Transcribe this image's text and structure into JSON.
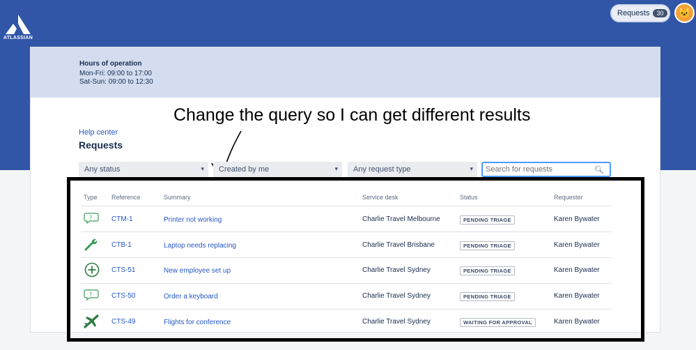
{
  "header": {
    "brand": "ATLASSIAN",
    "requests_label": "Requests",
    "requests_count": "30",
    "avatar_glyph": "🐱"
  },
  "hours": {
    "title": "Hours of operation",
    "weekdays": "Mon-Fri: 09:00 to 17:00",
    "weekend": "Sat-Sun: 09:00 to 12:30"
  },
  "annotation": "Change the query so I can get different results",
  "breadcrumb": "Help center",
  "page_title": "Requests",
  "filters": {
    "status": "Any status",
    "created_by": "Created by me",
    "request_type": "Any request type",
    "search_placeholder": "Search for requests"
  },
  "table": {
    "columns": [
      "Type",
      "Reference",
      "Summary",
      "Service desk",
      "Status",
      "Requester"
    ],
    "rows": [
      {
        "type_icon": "question-bubble-icon",
        "reference": "CTM-1",
        "summary": "Printer not working",
        "service_desk": "Charlie Travel Melbourne",
        "status": "PENDING TRIAGE",
        "requester": "Karen Bywater"
      },
      {
        "type_icon": "wrench-icon",
        "reference": "CTB-1",
        "summary": "Laptop needs replacing",
        "service_desk": "Charlie Travel Brisbane",
        "status": "PENDING TRIAGE",
        "requester": "Karen Bywater"
      },
      {
        "type_icon": "plus-circle-icon",
        "reference": "CTS-51",
        "summary": "New employee set up",
        "service_desk": "Charlie Travel Sydney",
        "status": "PENDING TRIAGE",
        "requester": "Karen Bywater"
      },
      {
        "type_icon": "question-bubble-icon",
        "reference": "CTS-50",
        "summary": "Order a keyboard",
        "service_desk": "Charlie Travel Sydney",
        "status": "PENDING TRIAGE",
        "requester": "Karen Bywater"
      },
      {
        "type_icon": "airplane-icon",
        "reference": "CTS-49",
        "summary": "Flights for conference",
        "service_desk": "Charlie Travel Sydney",
        "status": "WAITING FOR APPROVAL",
        "requester": "Karen Bywater"
      }
    ]
  },
  "colors": {
    "brand_blue": "#3156a8",
    "hours_band": "#d3ddef",
    "link": "#2557c5",
    "icon_green": "#3a9b5a"
  }
}
